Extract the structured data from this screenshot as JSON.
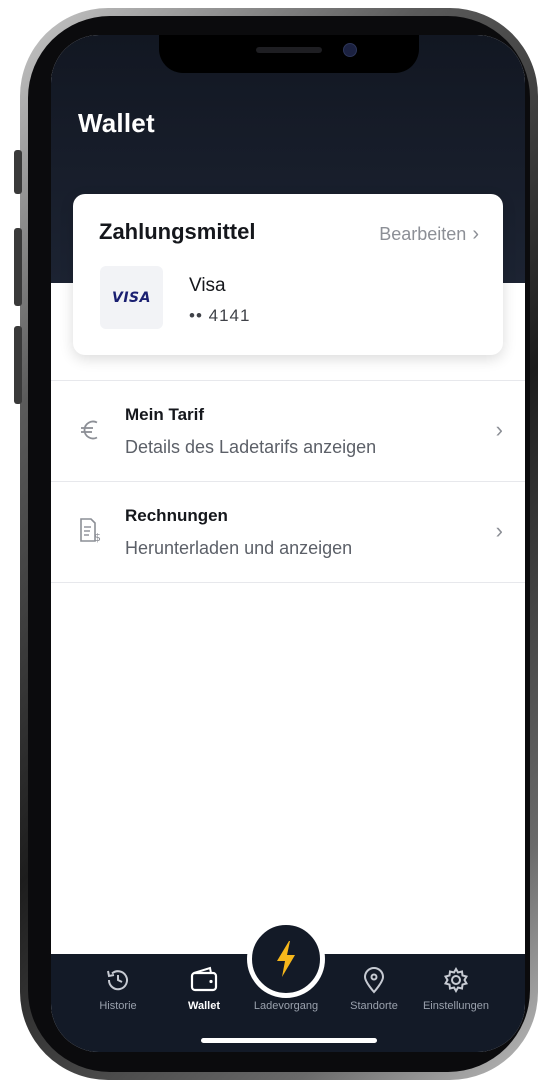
{
  "header": {
    "title": "Wallet"
  },
  "payment": {
    "title": "Zahlungsmittel",
    "edit_label": "Bearbeiten",
    "card_brand_logo": "VISA",
    "method_name": "Visa",
    "masked_number": "•• 4141"
  },
  "menu": [
    {
      "icon": "euro-icon",
      "title": "Mein Tarif",
      "subtitle": "Details des Ladetarifs anzeigen"
    },
    {
      "icon": "invoice-icon",
      "title": "Rechnungen",
      "subtitle": "Herunterladen und anzeigen"
    }
  ],
  "tabbar": {
    "active": "Wallet",
    "accent_color": "#f6b71b",
    "tabs": [
      {
        "icon": "history-icon",
        "label": "Historie"
      },
      {
        "icon": "wallet-icon",
        "label": "Wallet"
      },
      {
        "icon": "lightning-icon",
        "label": "Ladevorgang"
      },
      {
        "icon": "location-pin-icon",
        "label": "Standorte"
      },
      {
        "icon": "gear-icon",
        "label": "Einstellungen"
      }
    ]
  }
}
